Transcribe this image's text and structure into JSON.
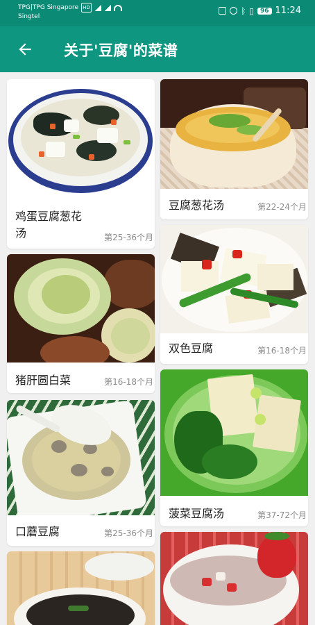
{
  "status_bar": {
    "carrier_line1": "TPG|TPG Singapore",
    "carrier_line2": "Singtel",
    "network_badge": "HD",
    "time": "11:24",
    "battery": "96"
  },
  "app_bar": {
    "title": "关于'豆腐'的菜谱",
    "back_icon": "arrow-left-icon"
  },
  "recipes": [
    {
      "name": "鸡蛋豆腐葱花汤",
      "age": "第25-36个月"
    },
    {
      "name": "豆腐葱花汤",
      "age": "第22-24个月"
    },
    {
      "name": "猪肝圆白菜",
      "age": "第16-18个月"
    },
    {
      "name": "双色豆腐",
      "age": "第16-18个月"
    },
    {
      "name": "口蘑豆腐",
      "age": "第25-36个月"
    },
    {
      "name": "菠菜豆腐汤",
      "age": "第37-72个月"
    },
    {
      "name": "",
      "age": ""
    },
    {
      "name": "",
      "age": ""
    }
  ],
  "colors": {
    "status_bar": "#0b8a76",
    "app_bar": "#0e9680",
    "background": "#f0f0f0",
    "card": "#ffffff",
    "age_text": "#8a8a8a"
  }
}
